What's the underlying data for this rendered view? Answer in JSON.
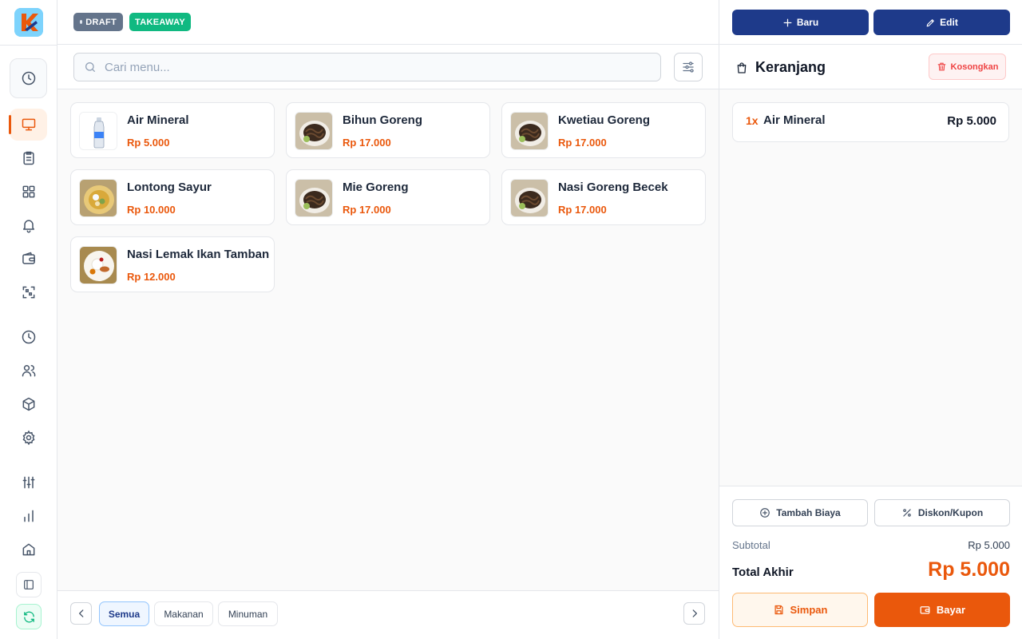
{
  "status_badges": {
    "draft": "DRAFT",
    "order_type": "TAKEAWAY"
  },
  "search": {
    "placeholder": "Cari menu..."
  },
  "menu": {
    "items": [
      {
        "name": "Air Mineral",
        "price": "Rp 5.000",
        "image": "water-bottle"
      },
      {
        "name": "Bihun Goreng",
        "price": "Rp 17.000",
        "image": "fried-noodle"
      },
      {
        "name": "Kwetiau Goreng",
        "price": "Rp 17.000",
        "image": "fried-noodle"
      },
      {
        "name": "Lontong Sayur",
        "price": "Rp 10.000",
        "image": "lontong-sayur"
      },
      {
        "name": "Mie Goreng",
        "price": "Rp 17.000",
        "image": "fried-noodle"
      },
      {
        "name": "Nasi Goreng Becek",
        "price": "Rp 17.000",
        "image": "fried-noodle"
      },
      {
        "name": "Nasi Lemak Ikan Tamban",
        "price": "Rp 12.000",
        "image": "nasi-lemak"
      }
    ]
  },
  "categories": {
    "items": [
      "Semua",
      "Makanan",
      "Minuman"
    ],
    "active": "Semua"
  },
  "header_actions": {
    "new_label": "Baru",
    "edit_label": "Edit"
  },
  "cart": {
    "title": "Keranjang",
    "clear_label": "Kosongkan",
    "items": [
      {
        "qty": "1x",
        "name": "Air Mineral",
        "price": "Rp 5.000"
      }
    ],
    "add_fee_label": "Tambah Biaya",
    "discount_label": "Diskon/Kupon",
    "subtotal_label": "Subtotal",
    "subtotal_value": "Rp 5.000",
    "total_label": "Total Akhir",
    "total_value": "Rp 5.000",
    "save_label": "Simpan",
    "pay_label": "Bayar"
  },
  "sidebar": {
    "icons": [
      "clock-icon",
      "monitor-icon",
      "clipboard-icon",
      "grid-icon",
      "bell-icon",
      "wallet-icon",
      "qr-scan-icon",
      "history-icon",
      "users-icon",
      "box-icon",
      "gear-icon",
      "sliders-icon",
      "bar-chart-icon",
      "home-icon",
      "sidebar-toggle-icon",
      "refresh-icon"
    ]
  },
  "colors": {
    "brand": "#ea580c",
    "navy": "#1e3a8a",
    "success": "#10b981",
    "danger": "#ef4444"
  }
}
